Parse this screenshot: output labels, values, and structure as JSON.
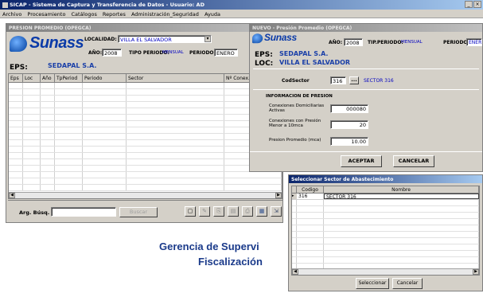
{
  "app": {
    "title": "SICAP - Sistema de Captura y Transferencia de Datos - Usuario: AD",
    "win_buttons": [
      "_",
      "×"
    ]
  },
  "menu": [
    "Archivo",
    "Procesamiento",
    "Catálogos",
    "Reportes",
    "Administración_Seguridad",
    "Ayuda"
  ],
  "list_window": {
    "title": "PRESION PROMEDIO (OPEGCA)",
    "logo_text": "Sunass",
    "localidad_label": "LOCALIDAD:",
    "localidad_value": "VILLA EL SALVADOR",
    "anio_label": "AÑO:",
    "anio_value": "2008",
    "tipo_periodo_label": "TIPO PERIODO:",
    "tipo_periodo_value": "MENSUAL",
    "periodo_label": "PERIODO:",
    "periodo_value": "ENERO",
    "eps_label": "EPS:",
    "eps_value": "SEDAPAL S.A.",
    "columns": [
      "Eps",
      "Loc",
      "Año",
      "TpPeriod",
      "Periodo",
      "Sector",
      "Nº Conex. Activas"
    ],
    "search_label": "Arg. Búsq. :",
    "search_value": "",
    "search_button": "Buscar"
  },
  "new_window": {
    "title": "NUEVO - Presión Promedio (OPEGCA)",
    "logo_text": "Sunass",
    "anio_label": "AÑO:",
    "anio_value": "2008",
    "tip_periodo_label": "TIP.PERIODO:",
    "tip_periodo_value": "MENSUAL",
    "periodo_label": "PERIODO:",
    "periodo_value": "ENERO",
    "eps_label": "EPS:",
    "eps_value": "SEDAPAL S.A.",
    "loc_label": "LOC:",
    "loc_value": "VILLA EL SALVADOR",
    "cod_sector_label": "CodSector",
    "cod_sector_value": "316",
    "ellipsis_button": "...",
    "sector_name": "SECTOR 316",
    "section_title": "INFORMACION DE PRESION",
    "conexiones_label": "Conexiones Domiciliarias Activas",
    "conexiones_value": "000080",
    "presion_menor_label": "Conexiones con Presión Menor a 10mca",
    "presion_menor_value": "20",
    "presion_prom_label": "Presion Promedio (mca)",
    "presion_prom_value": "10.00",
    "accept_button": "ACEPTAR",
    "cancel_button": "CANCELAR"
  },
  "selector_window": {
    "title": "Seleccionar Sector de Abastecimiento",
    "columns": [
      "Codigo",
      "Nombre"
    ],
    "rows": [
      {
        "codigo": "316",
        "nombre": "SECTOR 316"
      }
    ],
    "select_button": "Seleccionar",
    "cancel_button": "Cancelar"
  },
  "background": {
    "line1": "Gerencia de Supervi",
    "line2": "Fiscalización"
  }
}
